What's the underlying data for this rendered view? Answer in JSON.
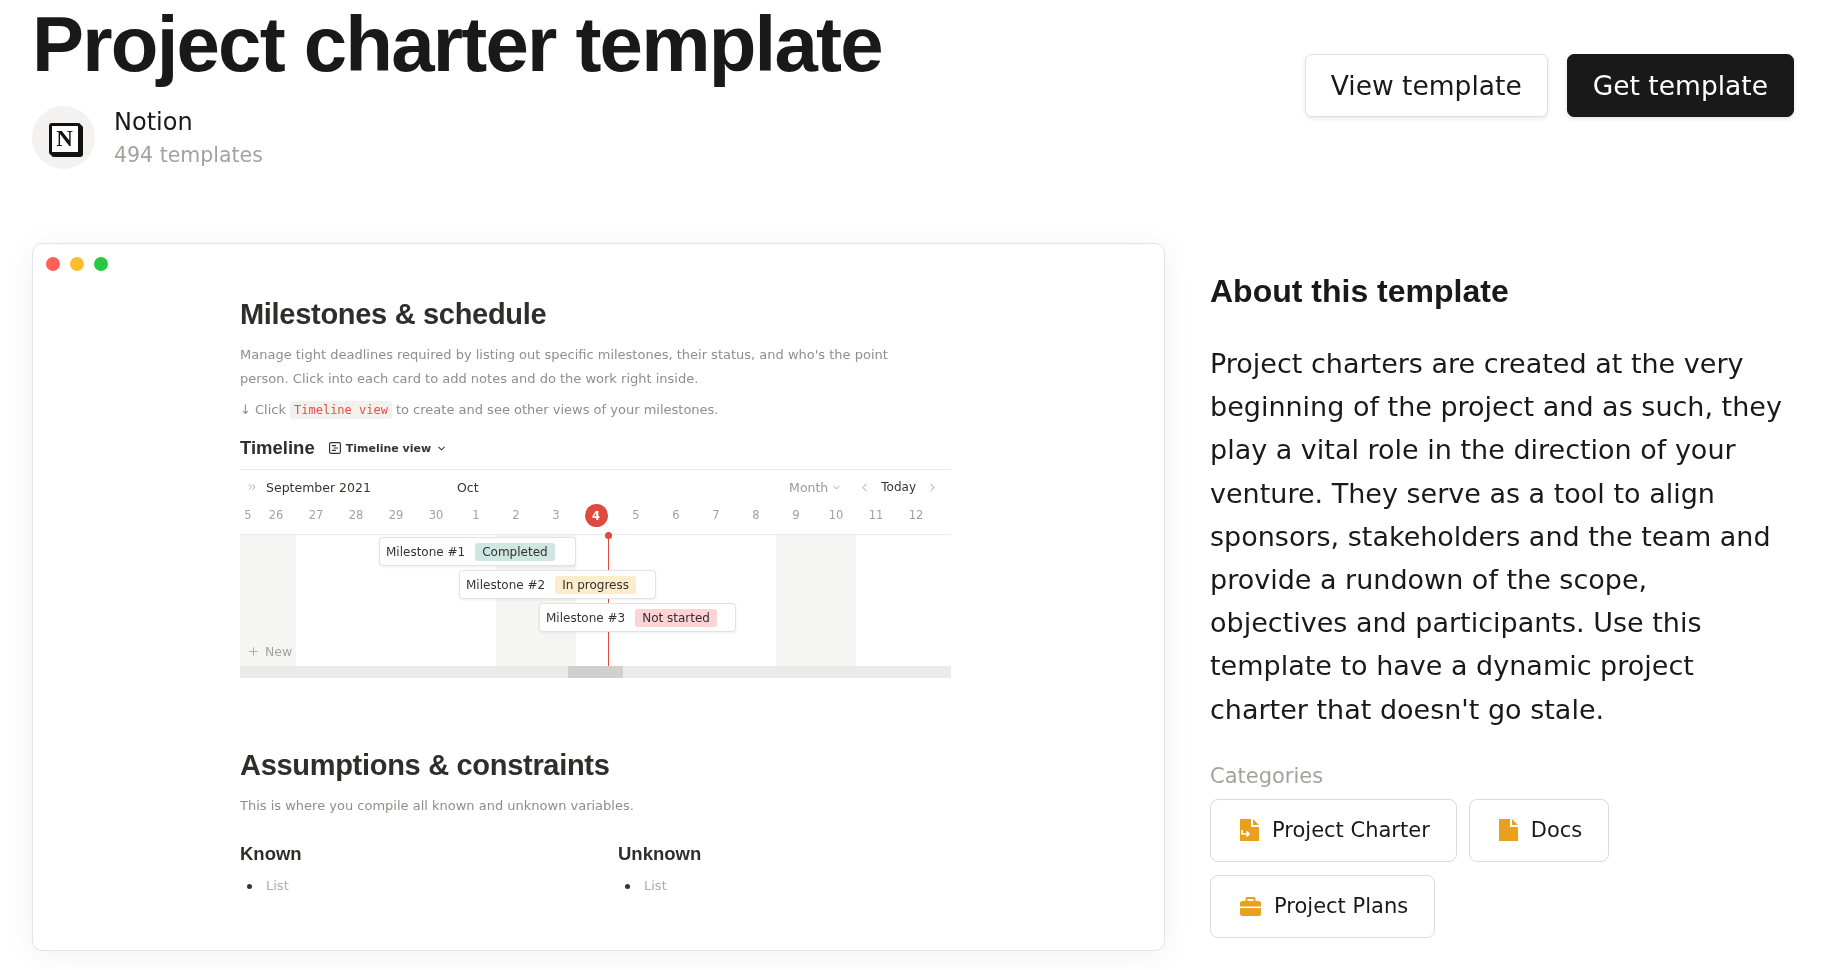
{
  "header": {
    "title": "Project charter template",
    "publisher": {
      "logo_letter": "N",
      "name": "Notion",
      "count": "494 templates"
    },
    "buttons": [
      {
        "label": "View template",
        "kind": "secondary"
      },
      {
        "label": "Get template",
        "kind": "primary"
      }
    ]
  },
  "preview": {
    "window_controls": [
      {
        "color": "#ff5f57"
      },
      {
        "color": "#febc2e"
      },
      {
        "color": "#28c840"
      }
    ],
    "milestones": {
      "title": "Milestones & schedule",
      "description": "Manage tight deadlines required by listing out specific milestones, their status, and who's the point person. Click into each card to add notes and do the work right inside.",
      "hint": {
        "before": "↓ Click",
        "code": "Timeline view",
        "after": "to create and see other views of your milestones."
      }
    },
    "timeline": {
      "title": "Timeline",
      "view": "Timeline view",
      "month": "September 2021",
      "next_month": "Oct",
      "scale": "Month",
      "today_button": "Today",
      "days": [
        {
          "label": "5",
          "weekend": true,
          "today": false
        },
        {
          "label": "26",
          "weekend": true,
          "today": false
        },
        {
          "label": "27",
          "weekend": false,
          "today": false
        },
        {
          "label": "28",
          "weekend": false,
          "today": false
        },
        {
          "label": "29",
          "weekend": false,
          "today": false
        },
        {
          "label": "30",
          "weekend": false,
          "today": false
        },
        {
          "label": "1",
          "weekend": false,
          "today": false
        },
        {
          "label": "2",
          "weekend": true,
          "today": false
        },
        {
          "label": "3",
          "weekend": true,
          "today": false
        },
        {
          "label": "4",
          "weekend": false,
          "today": true
        },
        {
          "label": "5",
          "weekend": false,
          "today": false
        },
        {
          "label": "6",
          "weekend": false,
          "today": false
        },
        {
          "label": "7",
          "weekend": false,
          "today": false
        },
        {
          "label": "8",
          "weekend": false,
          "today": false
        },
        {
          "label": "9",
          "weekend": true,
          "today": false
        },
        {
          "label": "10",
          "weekend": true,
          "today": false
        },
        {
          "label": "11",
          "weekend": false,
          "today": false
        },
        {
          "label": "12",
          "weekend": false,
          "today": false
        }
      ],
      "items": [
        {
          "name": "Milestone #1",
          "status": "Completed",
          "color": "#cfe7e1"
        },
        {
          "name": "Milestone #2",
          "status": "In progress",
          "color": "#fbedcc"
        },
        {
          "name": "Milestone #3",
          "status": "Not started",
          "color": "#fdd3d6"
        }
      ],
      "new_label": "New"
    },
    "assumptions": {
      "title": "Assumptions & constraints",
      "description": "This is where you compile all known and unknown variables.",
      "columns": [
        {
          "heading": "Known",
          "items": [
            {
              "placeholder": "List"
            }
          ]
        },
        {
          "heading": "Unknown",
          "items": [
            {
              "placeholder": "List"
            }
          ]
        }
      ]
    }
  },
  "about": {
    "title": "About this template",
    "body": [
      "Project charters are created at the very beginning of the project and as such, they play a vital role in the direction of your venture. They serve as a tool to align sponsors, stakeholders and the team and provide a rundown of the scope,",
      "objectives and participants. Use this template to have a dynamic project charter that doesn't go stale."
    ],
    "categories_label": "Categories",
    "categories": [
      {
        "label": "Project Charter",
        "kind": "charter"
      },
      {
        "label": "Docs",
        "kind": "doc"
      },
      {
        "label": "Project Plans",
        "kind": "plans"
      }
    ]
  }
}
